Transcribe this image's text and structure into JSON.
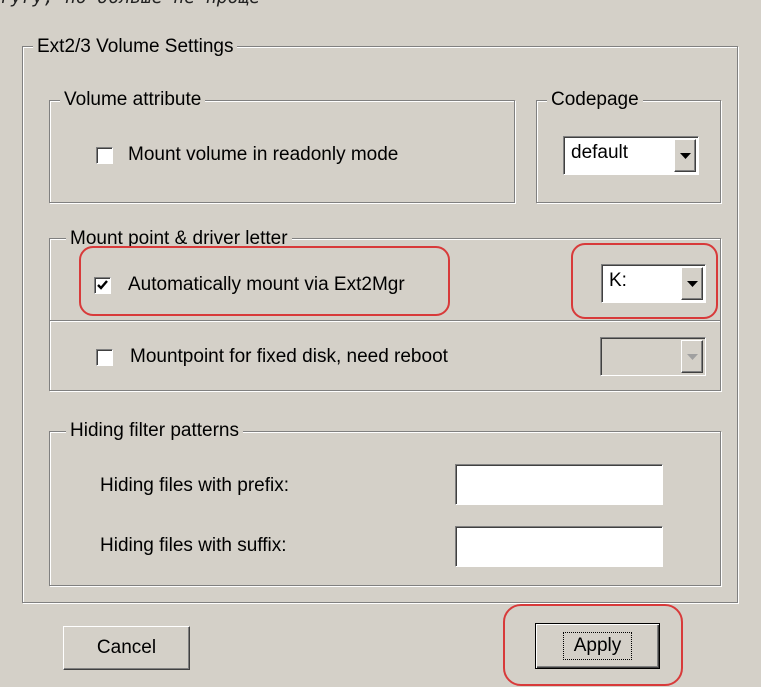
{
  "top_strip": "ryry, но больше не проще",
  "main_group": {
    "legend": "Ext2/3 Volume Settings"
  },
  "volume_attribute": {
    "legend": "Volume attribute",
    "readonly_label": "Mount volume in readonly mode",
    "readonly_checked": false
  },
  "codepage": {
    "legend": "Codepage",
    "selected": "default"
  },
  "mount_point": {
    "legend": "Mount point & driver letter",
    "auto_mount_label": "Automatically mount via Ext2Mgr",
    "auto_mount_checked": true,
    "drive_letter": "K:",
    "fixed_disk_label": "Mountpoint for fixed disk, need reboot",
    "fixed_disk_checked": false,
    "fixed_disk_value": ""
  },
  "hiding": {
    "legend": "Hiding filter patterns",
    "prefix_label": "Hiding files with prefix:",
    "prefix_value": "",
    "suffix_label": "Hiding files with suffix:",
    "suffix_value": ""
  },
  "buttons": {
    "cancel": "Cancel",
    "apply": "Apply"
  },
  "colors": {
    "background": "#d4d0c8",
    "highlight": "#d83a3a"
  }
}
